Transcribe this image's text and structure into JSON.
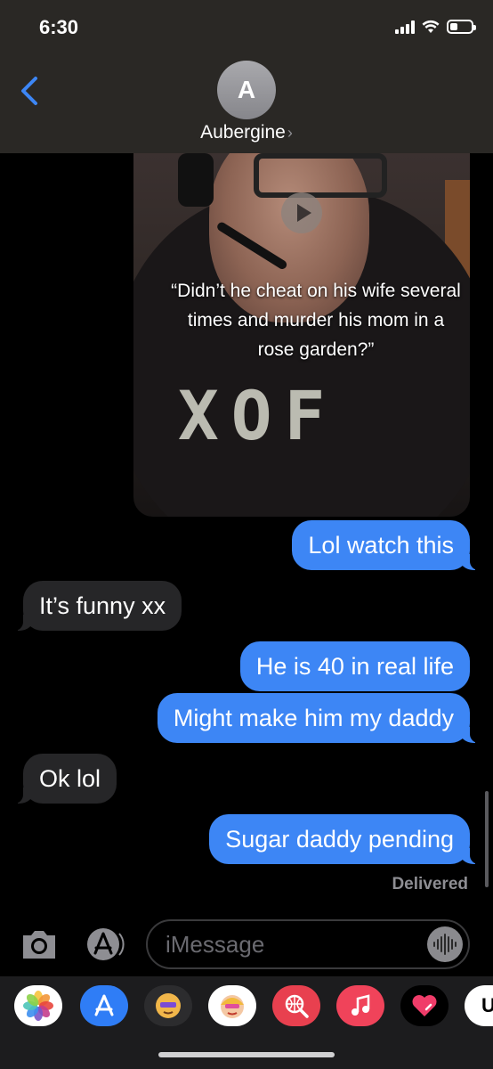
{
  "status_bar": {
    "time": "6:30"
  },
  "header": {
    "avatar_initial": "A",
    "contact_name": "Aubergine",
    "chevron": "›"
  },
  "video": {
    "caption": "“Didn’t he cheat on his wife several times and murder his mom in a rose garden?”",
    "shirt_text": "XOF"
  },
  "messages": [
    {
      "direction": "sent",
      "text": "Lol watch this"
    },
    {
      "direction": "received",
      "text": "It’s funny xx"
    },
    {
      "direction": "sent",
      "text": "He is 40 in real life"
    },
    {
      "direction": "sent",
      "text": "Might make him my daddy"
    },
    {
      "direction": "received",
      "text": "Ok lol"
    },
    {
      "direction": "sent",
      "text": "Sugar daddy pending"
    }
  ],
  "delivered_label": "Delivered",
  "input": {
    "placeholder": "iMessage"
  },
  "app_drawer": {
    "apps": [
      {
        "name": "Photos",
        "icon": "photos-icon"
      },
      {
        "name": "App Store",
        "icon": "appstore-icon"
      },
      {
        "name": "Memoji Stickers",
        "icon": "memoji-icon"
      },
      {
        "name": "Animoji",
        "icon": "memoji-icon"
      },
      {
        "name": "Web Search",
        "icon": "globe-search-icon"
      },
      {
        "name": "Music",
        "icon": "music-note-icon"
      },
      {
        "name": "Digital Touch",
        "icon": "heart-icon"
      },
      {
        "name": "More",
        "icon": "app-icon",
        "label": "U"
      }
    ]
  },
  "colors": {
    "sent_bubble": "#3d86f5",
    "received_bubble": "#262628",
    "accent": "#3d86f5"
  }
}
